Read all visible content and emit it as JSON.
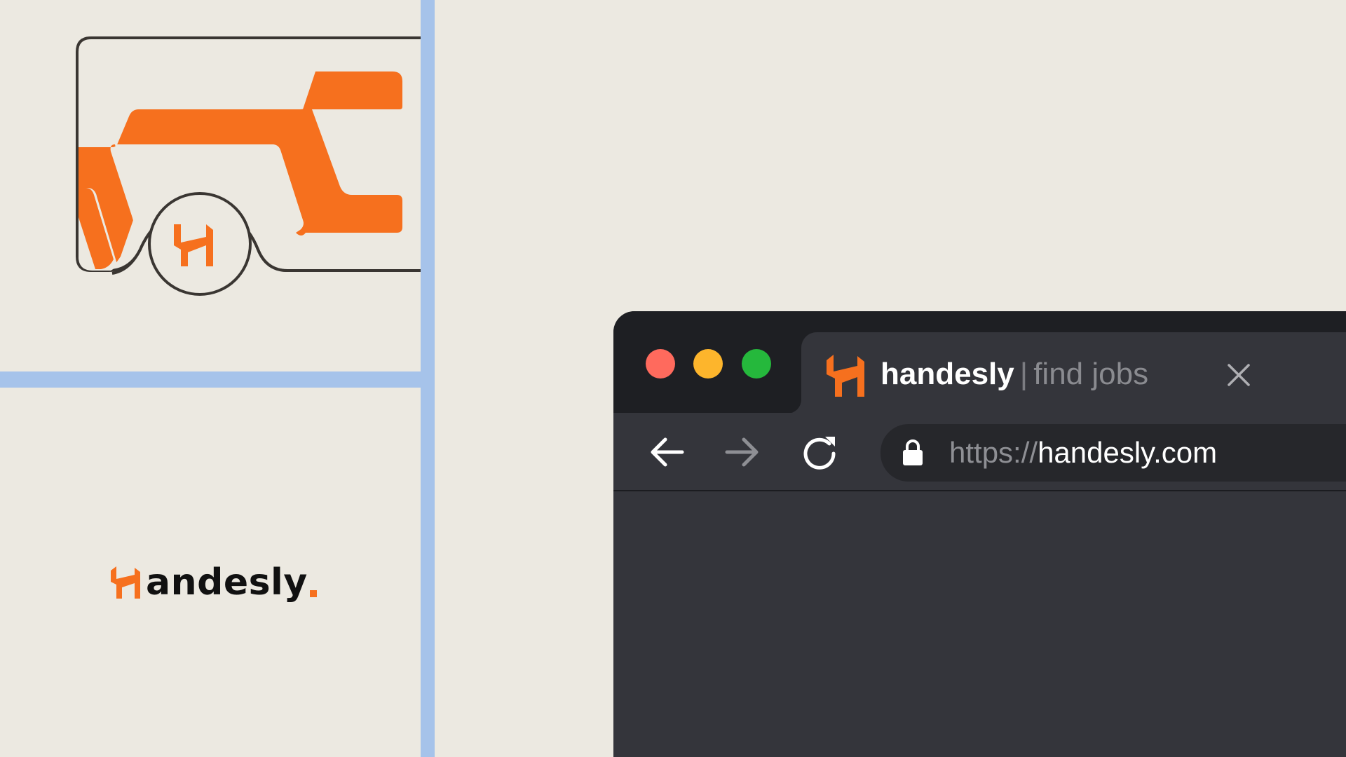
{
  "colors": {
    "background": "#ECE9E1",
    "accent_orange": "#F6701E",
    "divider_blue": "#A6C3EA",
    "browser_chrome": "#1E1F23",
    "browser_body": "#34353B"
  },
  "illustration": {
    "van_icon": "van-with-logo-wheel-icon"
  },
  "wordmark": {
    "text": "andesly",
    "icon": "handesly-h-icon"
  },
  "browser": {
    "traffic_lights": [
      "close",
      "minimize",
      "zoom"
    ],
    "tab": {
      "favicon": "handesly-h-icon",
      "title_main": "handesly",
      "title_sep": "|",
      "title_sub": "find jobs",
      "close_icon": "close-icon"
    },
    "toolbar": {
      "back_icon": "arrow-left-icon",
      "forward_icon": "arrow-right-icon",
      "reload_icon": "reload-icon"
    },
    "url": {
      "lock_icon": "lock-icon",
      "scheme": "https://",
      "host": "handesly.com"
    }
  }
}
